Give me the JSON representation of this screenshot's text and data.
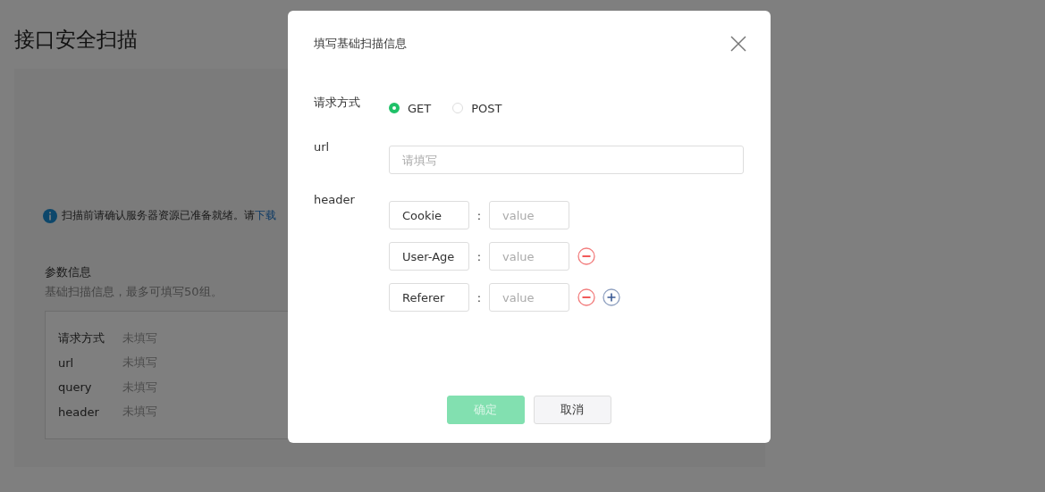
{
  "page": {
    "title": "接口安全扫描",
    "notice": {
      "text": "扫描前请确认服务器资源已准备就绪。请",
      "link": "下载"
    },
    "params": {
      "title": "参数信息",
      "hint": "基础扫描信息，最多可填写50组。",
      "rows": [
        {
          "label": "请求方式",
          "value": "未填写"
        },
        {
          "label": "url",
          "value": "未填写"
        },
        {
          "label": "query",
          "value": "未填写"
        },
        {
          "label": "header",
          "value": "未填写"
        }
      ]
    }
  },
  "dialog": {
    "title": "填写基础扫描信息",
    "method": {
      "label": "请求方式",
      "options": [
        {
          "label": "GET",
          "selected": true
        },
        {
          "label": "POST",
          "selected": false
        }
      ]
    },
    "url": {
      "label": "url",
      "placeholder": "请填写"
    },
    "header": {
      "label": "header",
      "separator": ":",
      "rows": [
        {
          "key": "Cookie",
          "placeholder": "value",
          "removable": false,
          "addable": false
        },
        {
          "key": "User-Age",
          "placeholder": "value",
          "removable": true,
          "addable": false
        },
        {
          "key": "Referer",
          "placeholder": "value",
          "removable": true,
          "addable": true
        }
      ]
    },
    "buttons": [
      {
        "label": "确定",
        "kind": "primary",
        "disabled": true
      },
      {
        "label": "取消",
        "kind": "default",
        "disabled": false
      }
    ]
  }
}
